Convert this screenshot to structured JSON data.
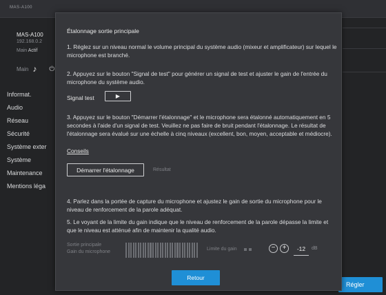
{
  "app": {
    "brand": "MAS-A100"
  },
  "device": {
    "name": "MAS-A100",
    "ip": "192.168.0.2",
    "state_label": "Main",
    "state_value": "Actif",
    "main_label": "Main"
  },
  "sidebar": {
    "items": [
      {
        "label": "Informat."
      },
      {
        "label": "Audio"
      },
      {
        "label": "Réseau"
      },
      {
        "label": "Sécurité"
      },
      {
        "label": "Système exter"
      },
      {
        "label": "Système"
      },
      {
        "label": "Maintenance"
      },
      {
        "label": "Mentions léga"
      }
    ],
    "active_index": 1
  },
  "dialog": {
    "title": "Étalonnage sortie principale",
    "step1": "1. Réglez sur un niveau normal le volume principal du système audio (mixeur et amplificateur) sur lequel le microphone est branché.",
    "step2": "2. Appuyez sur le bouton \"Signal de test\" pour générer un signal de test et ajuster le gain de l'entrée du microphone du système audio.",
    "signal_label": "Signal test",
    "step3": "3. Appuyez sur le bouton \"Démarrer l'étalonnage\" et le microphone sera étalonné automatiquement en 5 secondes à l'aide d'un signal de test. Veuillez ne pas faire de bruit pendant l'étalonnage. Le résultat de l'étalonnage sera évalué sur une échelle à cinq niveaux (excellent, bon, moyen, acceptable et médiocre).",
    "conseils": "Conseils",
    "start_button": "Démarrer l'étalonnage",
    "result_label": "Résultat",
    "step4": "4. Parlez dans la portée de capture du microphone et ajustez le gain de sortie du microphone pour le niveau de renforcement de la parole adéquat.",
    "step5": "5. Le voyant de la limite du gain indique que le niveau de renforcement de la parole dépasse la limite et que le niveau est atténué afin de maintenir la qualité audio.",
    "gain_label_1": "Sortie principale",
    "gain_label_2": "Gain du microphone",
    "limit_label": "Limite du gain",
    "gain_value": "-12",
    "gain_unit": "dB",
    "back_button": "Retour"
  },
  "footer": {
    "apply_button": "Régler"
  },
  "colors": {
    "accent": "#1f8fd6",
    "background": "#232426",
    "dialog": "#36373b"
  }
}
